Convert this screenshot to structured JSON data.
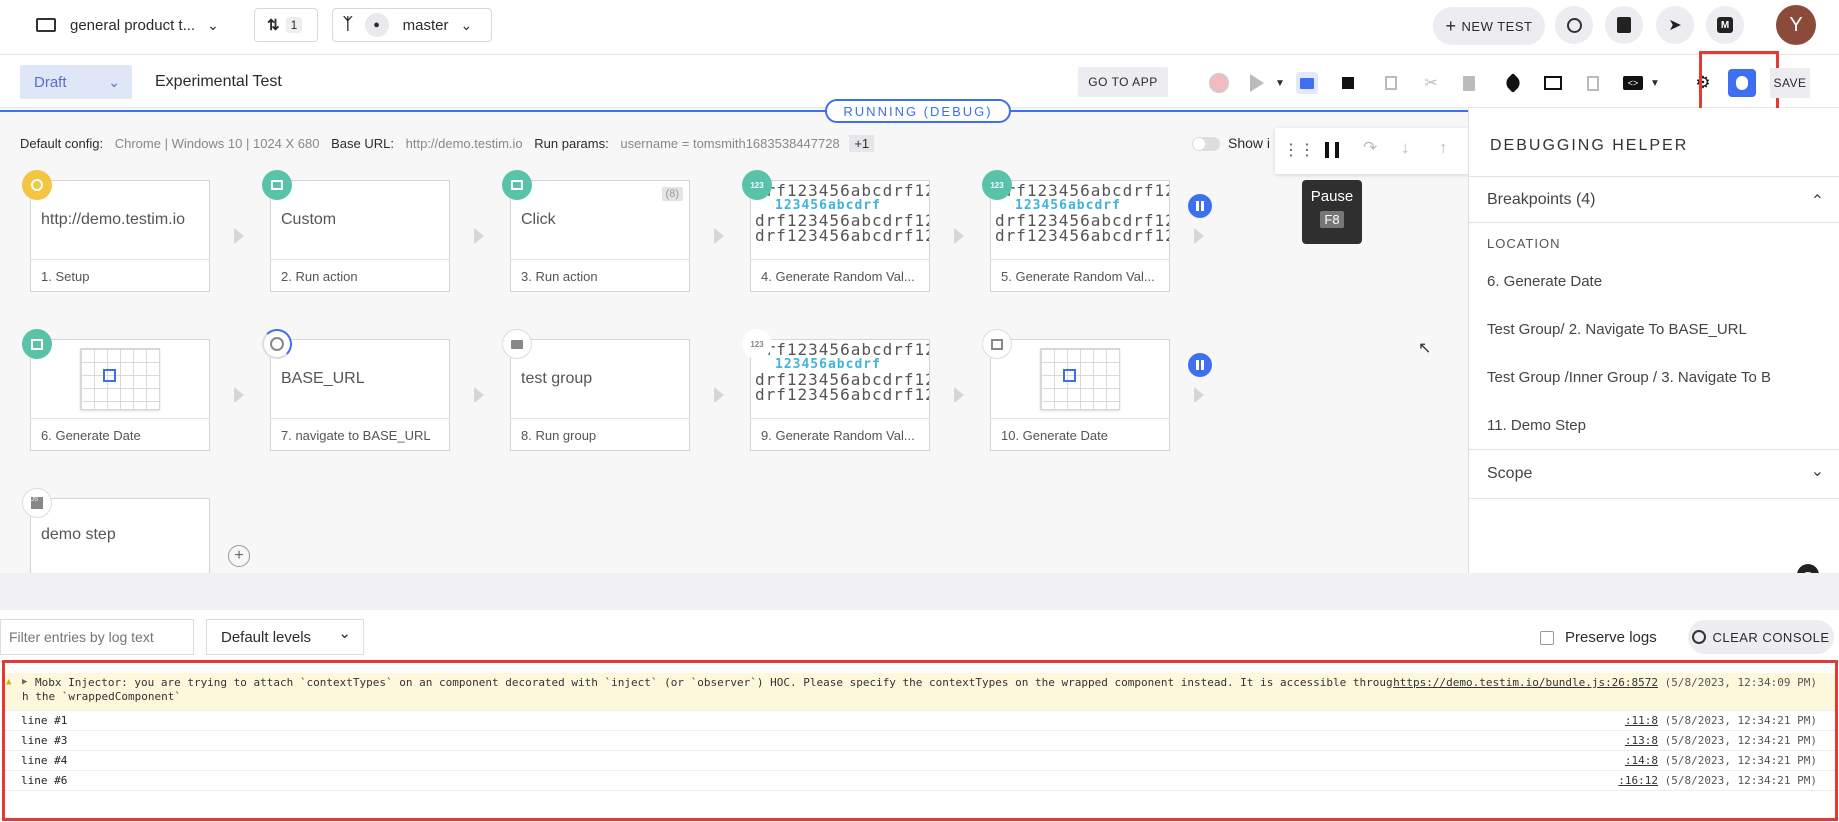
{
  "topbar": {
    "project_name": "general product t...",
    "pr_count": "1",
    "branch": "master",
    "new_test_label": "NEW TEST",
    "avatar_letter": "Y"
  },
  "editbar": {
    "status": "Draft",
    "test_name": "Experimental Test",
    "go_to_app": "GO TO APP",
    "save": "SAVE",
    "running_label": "RUNNING (DEBUG)"
  },
  "config": {
    "default_config_label": "Default config:",
    "default_config_value": "Chrome | Windows 10 | 1024 X 680",
    "base_url_label": "Base URL:",
    "base_url_value": "http://demo.testim.io",
    "run_params_label": "Run params:",
    "run_params_value": "username = tomsmith1683538447728",
    "run_params_more": "+1",
    "show_label": "Show i"
  },
  "tooltip": {
    "title": "Pause",
    "key": "F8"
  },
  "steps": [
    {
      "title": "http://demo.testim.io",
      "label": "1. Setup"
    },
    {
      "title": "Custom",
      "label": "2. Run action"
    },
    {
      "title": "Click",
      "label": "3. Run action",
      "tag": "(8)"
    },
    {
      "title": "",
      "label": "4. Generate Random Val..."
    },
    {
      "title": "",
      "label": "5. Generate Random Val..."
    },
    {
      "title": "",
      "label": "6. Generate Date"
    },
    {
      "title": "BASE_URL",
      "label": "7. navigate to BASE_URL"
    },
    {
      "title": "test group",
      "label": "8. Run group"
    },
    {
      "title": "",
      "label": "9. Generate Random Val..."
    },
    {
      "title": "",
      "label": "10. Generate Date"
    },
    {
      "title": "demo step",
      "label": ""
    }
  ],
  "random_text": {
    "line": "drf123456abcdrf12",
    "highlight": "123456abcdrf"
  },
  "panel": {
    "title": "DEBUGGING HELPER",
    "breakpoints_label": "Breakpoints (4)",
    "location_header": "LOCATION",
    "locations": [
      "6. Generate Date",
      "Test Group/ 2. Navigate To BASE_URL",
      "Test Group /Inner Group / 3. Navigate To B",
      "11. Demo Step"
    ],
    "scope_label": "Scope"
  },
  "console": {
    "filter_placeholder": "Filter entries by log text",
    "levels": "Default levels",
    "preserve_logs": "Preserve logs",
    "clear_console": "CLEAR CONSOLE",
    "warning": {
      "text1": "Mobx Injector: you are trying to attach `contextTypes` on an component decorated with `inject` (or `observer`) HOC. Please specify the contextTypes on the wrapped component instead. It is accessible throug",
      "text2": "h the `wrappedComponent`",
      "link": "https://demo.testim.io/bundle.js:26:8572",
      "time": "(5/8/2023, 12:34:09 PM)"
    },
    "logs": [
      {
        "text": "line #1",
        "link": ":11:8",
        "time": "(5/8/2023, 12:34:21 PM)"
      },
      {
        "text": "line #3",
        "link": ":13:8",
        "time": "(5/8/2023, 12:34:21 PM)"
      },
      {
        "text": "line #4",
        "link": ":14:8",
        "time": "(5/8/2023, 12:34:21 PM)"
      },
      {
        "text": "line #6",
        "link": ":16:12",
        "time": "(5/8/2023, 12:34:21 PM)"
      }
    ]
  },
  "colors": {
    "accent": "#3d6ff0",
    "highlight_border": "#e53935",
    "badge_teal": "#58c3a9"
  }
}
